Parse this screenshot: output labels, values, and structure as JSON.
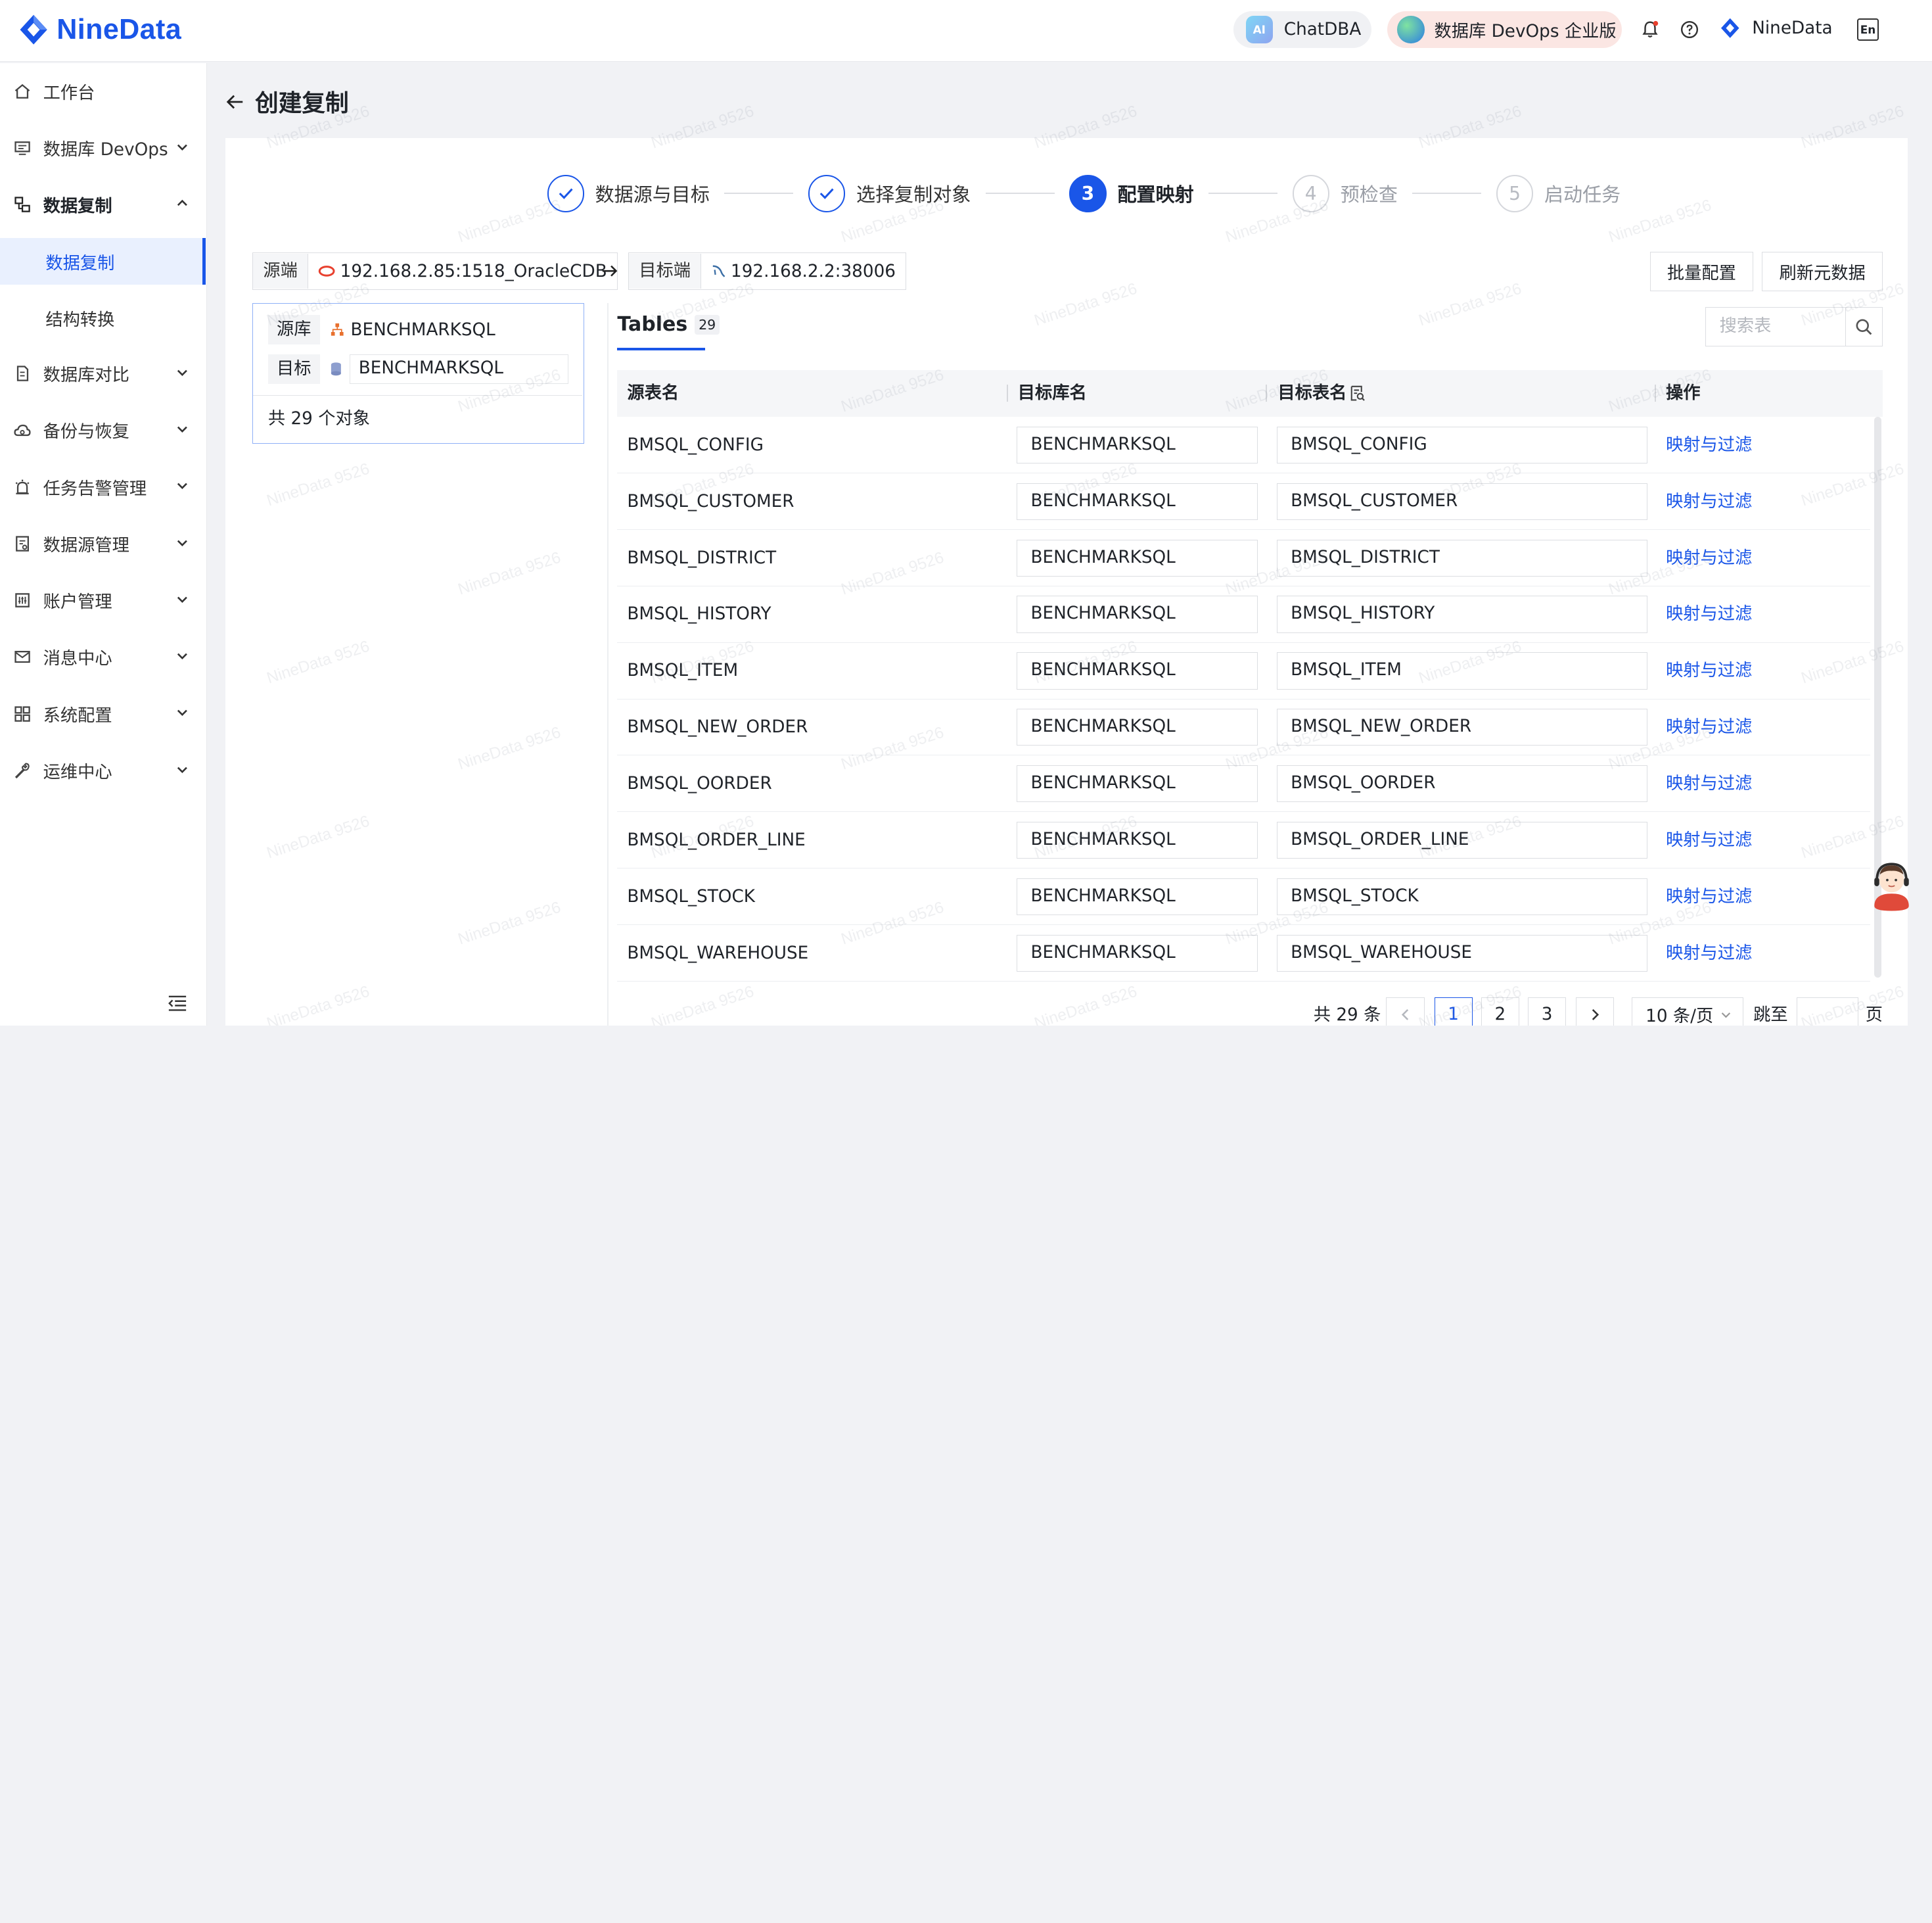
{
  "brand": {
    "name": "NineData"
  },
  "header": {
    "chatdba_label": "ChatDBA",
    "ai_badge": "AI",
    "devops_label": "数据库 DevOps 企业版",
    "user_name": "NineData",
    "lang_badge": "En",
    "icons": [
      "bell-icon",
      "help-icon",
      "language-icon"
    ]
  },
  "sidebar": {
    "items": [
      {
        "label": "工作台",
        "icon": "home-icon"
      },
      {
        "label": "数据库 DevOps",
        "icon": "monitor-icon"
      },
      {
        "label": "数据复制",
        "icon": "replication-icon"
      },
      {
        "label": "数据复制",
        "active": true
      },
      {
        "label": "结构转换"
      },
      {
        "label": "数据库对比",
        "icon": "compare-icon"
      },
      {
        "label": "备份与恢复",
        "icon": "cloud-backup-icon"
      },
      {
        "label": "任务告警管理",
        "icon": "alarm-icon"
      },
      {
        "label": "数据源管理",
        "icon": "datasource-icon"
      },
      {
        "label": "账户管理",
        "icon": "account-icon"
      },
      {
        "label": "消息中心",
        "icon": "mail-icon"
      },
      {
        "label": "系统配置",
        "icon": "grid-icon"
      },
      {
        "label": "运维中心",
        "icon": "wrench-icon"
      }
    ]
  },
  "page": {
    "title": "创建复制"
  },
  "steps": [
    {
      "num": "1",
      "label": "数据源与目标",
      "state": "done"
    },
    {
      "num": "2",
      "label": "选择复制对象",
      "state": "done"
    },
    {
      "num": "3",
      "label": "配置映射",
      "state": "current"
    },
    {
      "num": "4",
      "label": "预检查",
      "state": "todo"
    },
    {
      "num": "5",
      "label": "启动任务",
      "state": "todo"
    }
  ],
  "connection": {
    "source_label": "源端",
    "source_value": "192.168.2.85:1518_OracleCDB",
    "target_label": "目标端",
    "target_value": "192.168.2.2:38006"
  },
  "actions": {
    "batch": "批量配置",
    "refresh": "刷新元数据"
  },
  "mapping_panel": {
    "source_tag": "源库",
    "source_db": "BENCHMARKSQL",
    "target_tag": "目标",
    "target_db": "BENCHMARKSQL",
    "count_text": "共 29 个对象"
  },
  "tables_tab": {
    "label": "Tables",
    "count": "29"
  },
  "search": {
    "placeholder": "搜索表"
  },
  "table": {
    "headers": [
      "源表名",
      "目标库名",
      "目标表名",
      "操作"
    ],
    "rows": [
      {
        "src": "BMSQL_CONFIG",
        "db": "BENCHMARKSQL",
        "tb": "BMSQL_CONFIG",
        "op": "映射与过滤"
      },
      {
        "src": "BMSQL_CUSTOMER",
        "db": "BENCHMARKSQL",
        "tb": "BMSQL_CUSTOMER",
        "op": "映射与过滤"
      },
      {
        "src": "BMSQL_DISTRICT",
        "db": "BENCHMARKSQL",
        "tb": "BMSQL_DISTRICT",
        "op": "映射与过滤"
      },
      {
        "src": "BMSQL_HISTORY",
        "db": "BENCHMARKSQL",
        "tb": "BMSQL_HISTORY",
        "op": "映射与过滤"
      },
      {
        "src": "BMSQL_ITEM",
        "db": "BENCHMARKSQL",
        "tb": "BMSQL_ITEM",
        "op": "映射与过滤"
      },
      {
        "src": "BMSQL_NEW_ORDER",
        "db": "BENCHMARKSQL",
        "tb": "BMSQL_NEW_ORDER",
        "op": "映射与过滤"
      },
      {
        "src": "BMSQL_OORDER",
        "db": "BENCHMARKSQL",
        "tb": "BMSQL_OORDER",
        "op": "映射与过滤"
      },
      {
        "src": "BMSQL_ORDER_LINE",
        "db": "BENCHMARKSQL",
        "tb": "BMSQL_ORDER_LINE",
        "op": "映射与过滤"
      },
      {
        "src": "BMSQL_STOCK",
        "db": "BENCHMARKSQL",
        "tb": "BMSQL_STOCK",
        "op": "映射与过滤"
      },
      {
        "src": "BMSQL_WAREHOUSE",
        "db": "BENCHMARKSQL",
        "tb": "BMSQL_WAREHOUSE",
        "op": "映射与过滤"
      }
    ]
  },
  "pagination": {
    "total": "共 29 条",
    "pages": [
      "1",
      "2",
      "3"
    ],
    "current": "1",
    "page_size": "10 条/页",
    "jump_label": "跳至",
    "page_suffix": "页"
  },
  "watermark": "NineData 9526",
  "colors": {
    "primary": "#1a56e8",
    "danger_icon": "#e8402e"
  }
}
